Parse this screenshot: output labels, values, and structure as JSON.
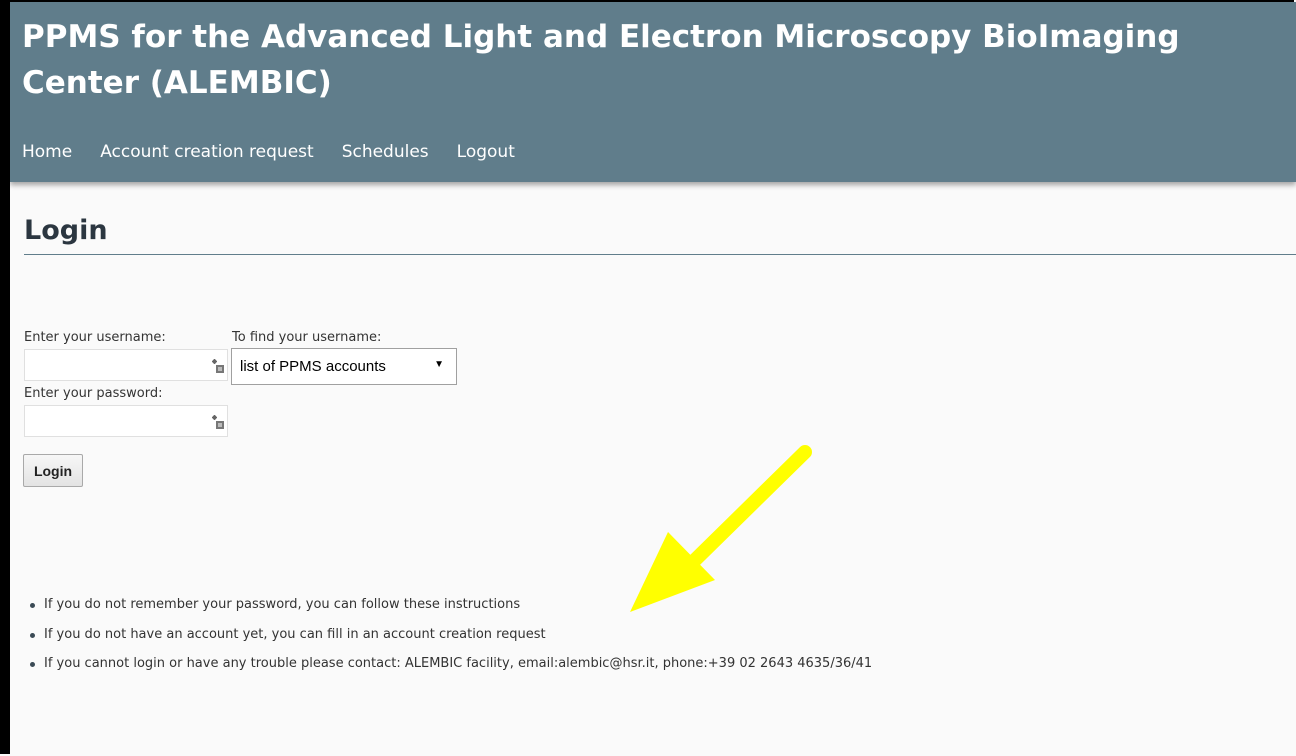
{
  "header": {
    "title": "PPMS for the Advanced Light and Electron Microscopy BioImaging Center (ALEMBIC)",
    "nav": [
      "Home",
      "Account creation request",
      "Schedules",
      "Logout"
    ]
  },
  "page": {
    "heading": "Login"
  },
  "form": {
    "username_label": "Enter your username:",
    "find_label": "To find your username:",
    "password_label": "Enter your password:",
    "username_value": "",
    "password_value": "",
    "find_select": {
      "selected": "list of PPMS accounts"
    },
    "login_button": "Login"
  },
  "info": [
    "If you do not remember your password, you can follow these instructions",
    "If you do not have an account yet, you can fill in an account creation request",
    "If you cannot login or have any trouble please contact: ALEMBIC facility, email:alembic@hsr.it, phone:+39 02 2643 4635/36/41"
  ],
  "icons": {
    "field_icon": "keyboard-key-icon",
    "annotation": "yellow-arrow-icon"
  },
  "colors": {
    "header": "#607d8b",
    "annotation": "#ffff00"
  }
}
